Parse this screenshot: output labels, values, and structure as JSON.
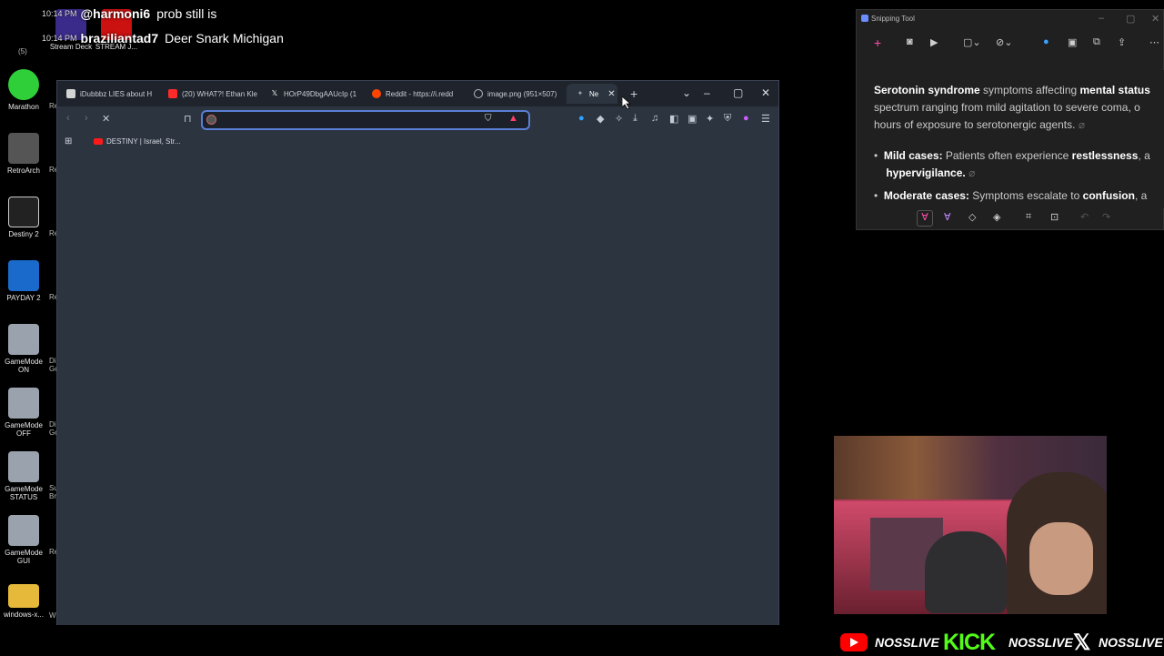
{
  "chat": [
    {
      "time": "10:14 PM",
      "user": "@harmoni6",
      "message": "prob still is"
    },
    {
      "time": "10:14 PM",
      "user": "braziliantad7",
      "message": "Deer Snark Michigan"
    }
  ],
  "desktop_icons": [
    {
      "label": "Stream Deck",
      "color": "#3a2a8a"
    },
    {
      "label": "STREAM J...",
      "color": "#cc1111"
    },
    {
      "label": "Marathon",
      "color": "#2fcf3a"
    },
    {
      "label": "RetroArch",
      "color": "#bbbbbb"
    },
    {
      "label": "Destiny 2",
      "color": "#cccccc"
    },
    {
      "label": "PAYDAY 2",
      "color": "#1a6acb"
    },
    {
      "label": "GameMode ON",
      "color": "#cfcfcf"
    },
    {
      "label": "GameMode OFF",
      "color": "#cfcfcf"
    },
    {
      "label": "GameMode STATUS",
      "color": "#cfcfcf"
    },
    {
      "label": "GameMode GUI",
      "color": "#cfcfcf"
    },
    {
      "label": "windows-x...",
      "color": "#e7b93a"
    }
  ],
  "side_labels": [
    "(5)",
    "Re",
    "Re",
    "Re",
    "Re",
    "Di Go",
    "Di Go",
    "Su Br",
    "Re",
    "Wi"
  ],
  "browser": {
    "tabs": [
      {
        "label": "iDubbbz LIES about H",
        "icon": "#d4d4d4"
      },
      {
        "label": "(20) WHAT?! Ethan Kle",
        "icon": "#ff2a2a"
      },
      {
        "label": "HOrP49DbgAAUcIp (1",
        "icon": "#ffffff"
      },
      {
        "label": "Reddit - https://i.redd",
        "icon": "#ff4500"
      },
      {
        "label": "image.png (951×507)",
        "icon": "#b8bdc4"
      },
      {
        "label": "Ne",
        "icon": "#9aa0a8",
        "active": true
      }
    ],
    "address_value": "",
    "bookmark": "DESTINY | Israel, Str..."
  },
  "snipping_tool": {
    "title": "Snipping Tool",
    "line1_bold": "Serotonin syndrome",
    "line1_rest": " symptoms affecting ",
    "line1_bold2": "mental status",
    "line2": "spectrum ranging from mild agitation to severe coma, o",
    "line3": "hours of exposure to serotonergic agents.",
    "bullet1_bold": "Mild cases:",
    "bullet1_rest": " Patients often experience ",
    "bullet1_bold2": "restlessness",
    "bullet1_tail": ", a",
    "bullet1_line2": "hypervigilance.",
    "bullet2_bold": "Moderate cases:",
    "bullet2_rest": " Symptoms escalate to ",
    "bullet2_bold2": "confusion",
    "bullet2_tail": ", a"
  },
  "social": [
    {
      "platform": "youtube",
      "handle": "NOSSLIVE"
    },
    {
      "platform": "kick",
      "logo": "KICK",
      "handle": "NOSSLIVE"
    },
    {
      "platform": "x",
      "handle": "NOSSLIVE"
    }
  ]
}
